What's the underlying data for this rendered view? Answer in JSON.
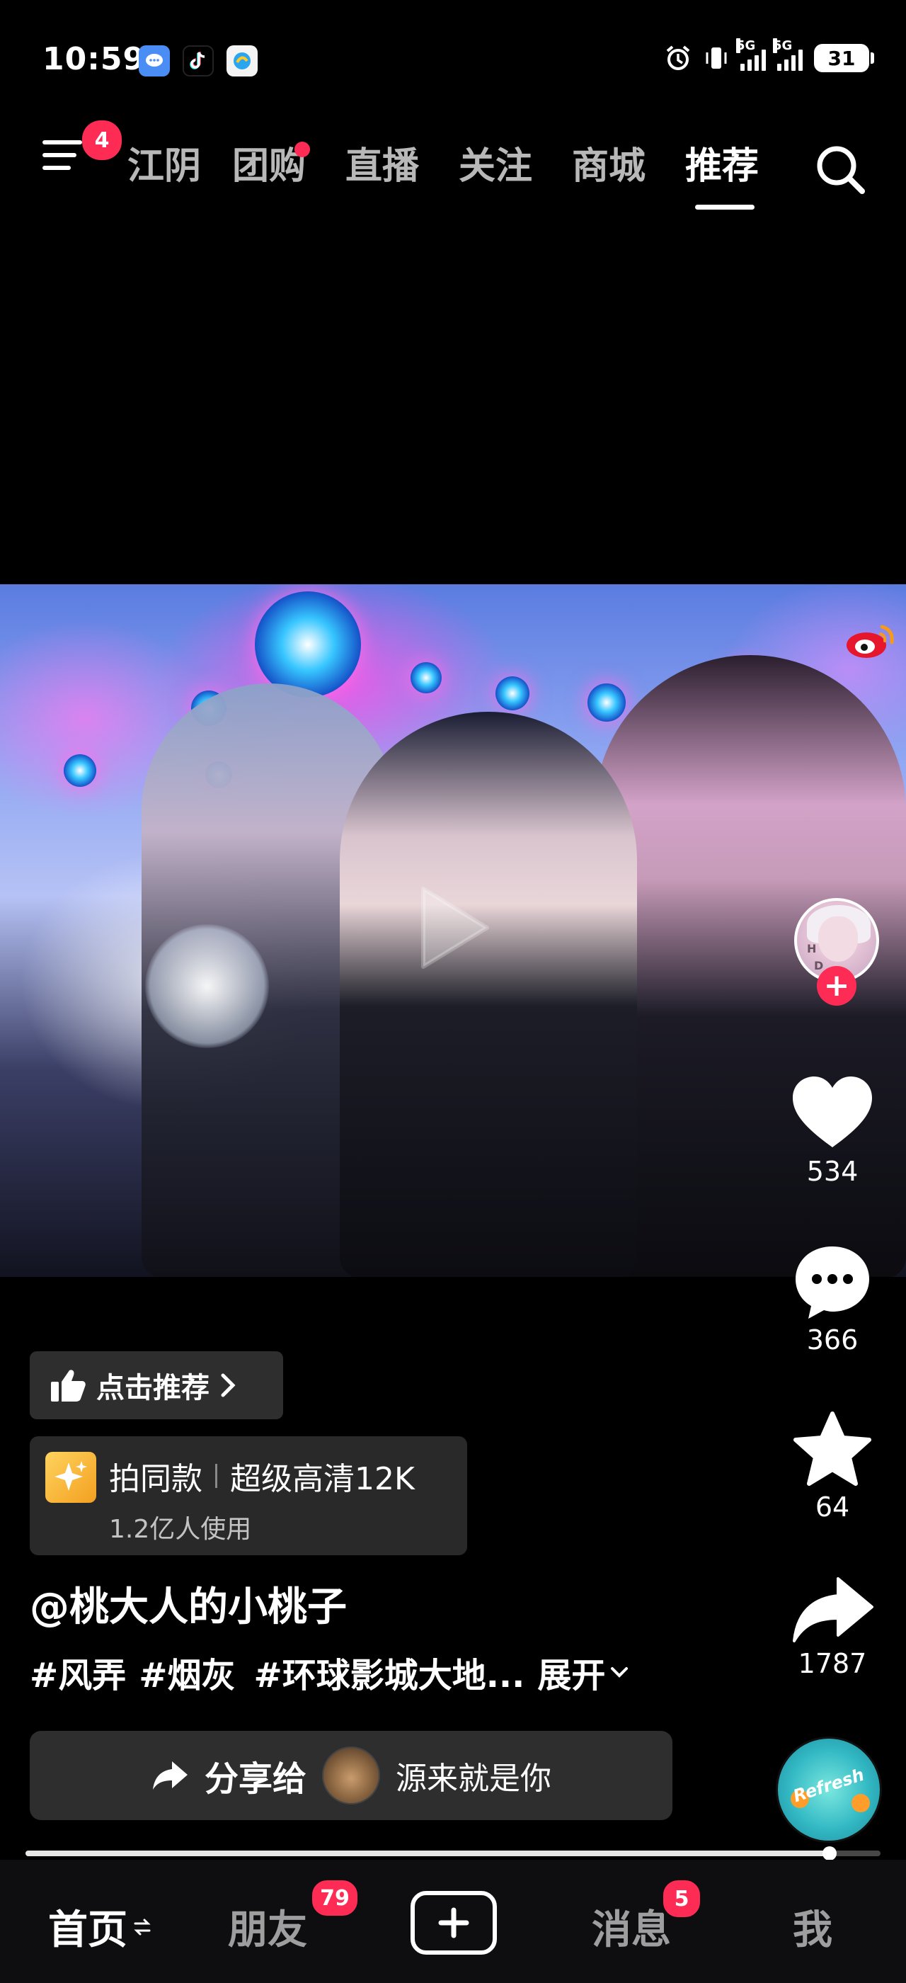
{
  "status_bar": {
    "time": "10:59",
    "notification_icons": [
      "message-app-icon",
      "tiktok-icon",
      "mini-program-icon"
    ],
    "system_icons": [
      "alarm-icon",
      "vibrate-icon",
      "signal-5g-icon",
      "signal-5g-icon"
    ],
    "signal_labels": [
      "5G",
      "5G"
    ],
    "battery": "31"
  },
  "top_nav": {
    "menu_badge": "4",
    "tabs": [
      {
        "label": "江阴",
        "active": false
      },
      {
        "label": "团购",
        "active": false,
        "dot": true
      },
      {
        "label": "直播",
        "active": false
      },
      {
        "label": "关注",
        "active": false
      },
      {
        "label": "商城",
        "active": false
      },
      {
        "label": "推荐",
        "active": true
      }
    ]
  },
  "actions": {
    "likes": "534",
    "comments": "366",
    "favorites": "64",
    "shares": "1787"
  },
  "info": {
    "recommend_label": "点击推荐",
    "template": {
      "action": "拍同款",
      "name": "超级高清12K",
      "usage": "1.2亿人使用"
    },
    "author": "@桃大人的小桃子",
    "hashtags": [
      "#风弄",
      "#烟灰",
      "#环球影城大地..."
    ],
    "expand_label": "展开",
    "share": {
      "label": "分享给",
      "recipient": "源来就是你"
    }
  },
  "playback": {
    "progress": 0.94
  },
  "bottom_nav": {
    "home": "首页",
    "friends": "朋友",
    "friends_badge": "79",
    "messages": "消息",
    "messages_badge": "5",
    "me": "我"
  },
  "colors": {
    "accent_red": "#fe2c55",
    "background": "#000000"
  }
}
